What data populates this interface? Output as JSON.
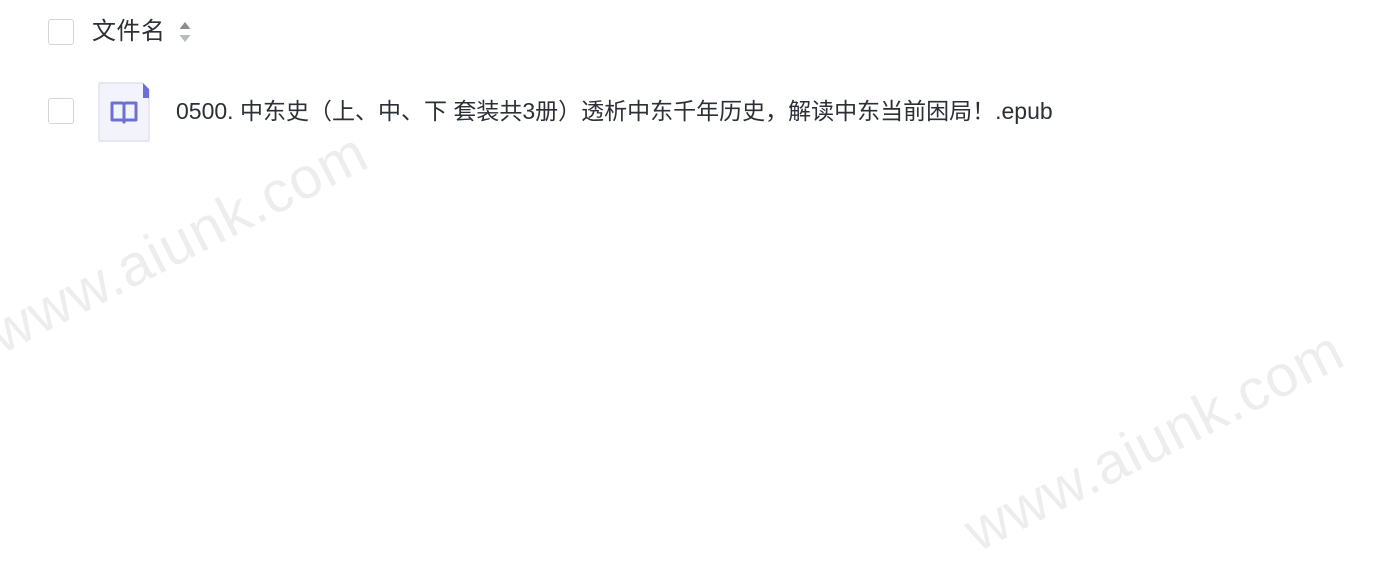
{
  "header": {
    "column_label": "文件名",
    "sort_icon": "sort-updown-icon",
    "select_all_checked": false
  },
  "files": [
    {
      "name": "0500. 中东史（上、中、下 套装共3册）透析中东千年历史，解读中东当前困局！.epub",
      "icon": "book-icon",
      "checked": false
    }
  ],
  "watermarks": [
    "www.aiunk.com",
    "www.aiunk.com"
  ],
  "colors": {
    "icon_accent": "#6b6fd6",
    "icon_bg": "#f3f3fc",
    "checkbox_border": "#d3d5da",
    "text": "#2b2f36"
  }
}
